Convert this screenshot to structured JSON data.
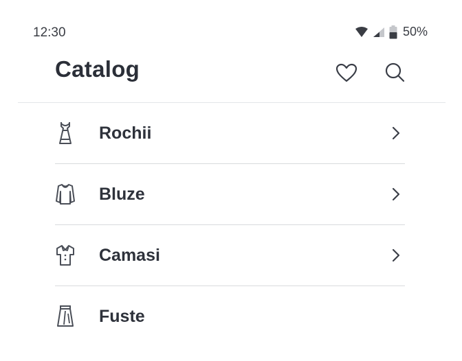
{
  "status_bar": {
    "time": "12:30",
    "battery": "50%",
    "icons": [
      "wifi-icon",
      "signal-icon",
      "battery-icon"
    ]
  },
  "header": {
    "title": "Catalog",
    "actions": [
      "heart-icon",
      "search-icon"
    ]
  },
  "categories": [
    {
      "label": "Rochii",
      "icon": "dress-icon",
      "has_chevron": true
    },
    {
      "label": "Bluze",
      "icon": "blouse-icon",
      "has_chevron": true
    },
    {
      "label": "Camasi",
      "icon": "shirt-icon",
      "has_chevron": true
    },
    {
      "label": "Fuste",
      "icon": "skirt-icon",
      "has_chevron": false
    }
  ],
  "colors": {
    "text": "#2b2f38",
    "icon": "#4a4e57",
    "divider": "#d8dadd",
    "background": "#ffffff"
  }
}
